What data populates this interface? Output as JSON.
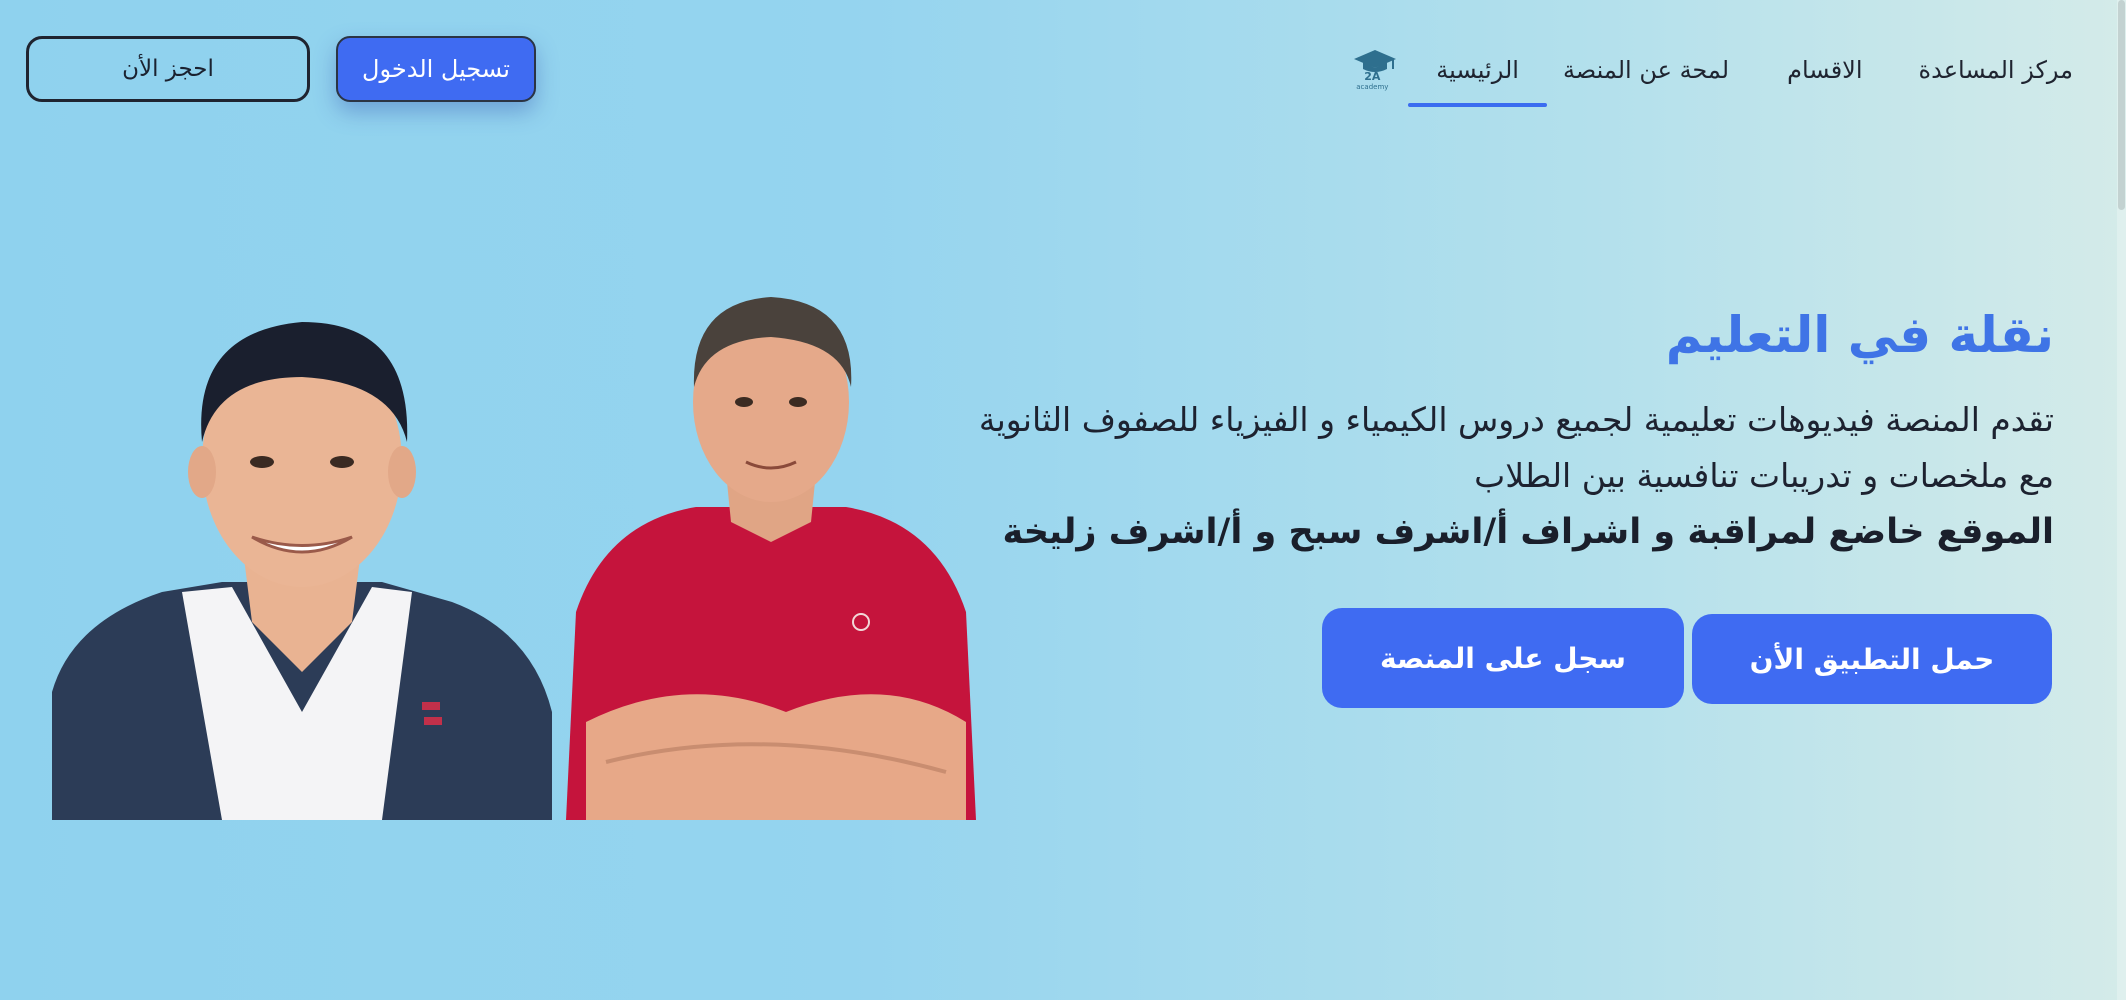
{
  "nav": {
    "home": "الرئيسية",
    "about": "لمحة عن المنصة",
    "sections": "الاقسام",
    "help": "مركز المساعدة",
    "logo_text": "2A",
    "logo_sub": "academy"
  },
  "header_buttons": {
    "login": "تسجيل الدخول",
    "book": "احجز الأن"
  },
  "hero": {
    "title": "نقلة في التعليم",
    "line1": "تقدم المنصة فيديوهات تعليمية لجميع دروس الكيمياء و الفيزياء للصفوف الثانوية",
    "line2": "مع ملخصات و تدريبات تنافسية بين الطلاب",
    "line3": "الموقع خاضع لمراقبة و اشراف أ/اشرف سبح و أ/اشرف زليخة"
  },
  "cta": {
    "download_app": "حمل التطبيق الأن",
    "register": "سجل على المنصة"
  },
  "colors": {
    "accent": "#3f6bf2",
    "title": "#3f74e6",
    "bg_left": "#8fd2ee",
    "bg_right": "#d4ebe9"
  }
}
